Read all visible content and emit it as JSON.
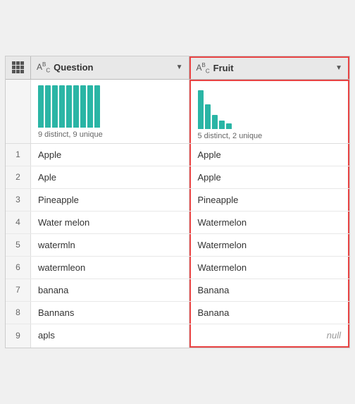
{
  "columns": {
    "rowNumHeader": {
      "icon": "grid"
    },
    "question": {
      "label": "Question",
      "type": "ABC",
      "histogramLabel": "9 distinct, 9 unique",
      "bars": [
        60,
        60,
        60,
        60,
        60,
        60,
        60,
        60,
        60
      ]
    },
    "fruit": {
      "label": "Fruit",
      "type": "ABC",
      "histogramLabel": "5 distinct, 2 unique",
      "bars": [
        55,
        35,
        20,
        12,
        8
      ]
    }
  },
  "rows": [
    {
      "num": "1",
      "question": "Apple",
      "fruit": "Apple"
    },
    {
      "num": "2",
      "question": "Aple",
      "fruit": "Apple"
    },
    {
      "num": "3",
      "question": "Pineapple",
      "fruit": "Pineapple"
    },
    {
      "num": "4",
      "question": "Water melon",
      "fruit": "Watermelon"
    },
    {
      "num": "5",
      "question": "watermln",
      "fruit": "Watermelon"
    },
    {
      "num": "6",
      "question": "watermleon",
      "fruit": "Watermelon"
    },
    {
      "num": "7",
      "question": "banana",
      "fruit": "Banana"
    },
    {
      "num": "8",
      "question": "Bannans",
      "fruit": "Banana"
    },
    {
      "num": "9",
      "question": "apls",
      "fruit": null
    }
  ]
}
